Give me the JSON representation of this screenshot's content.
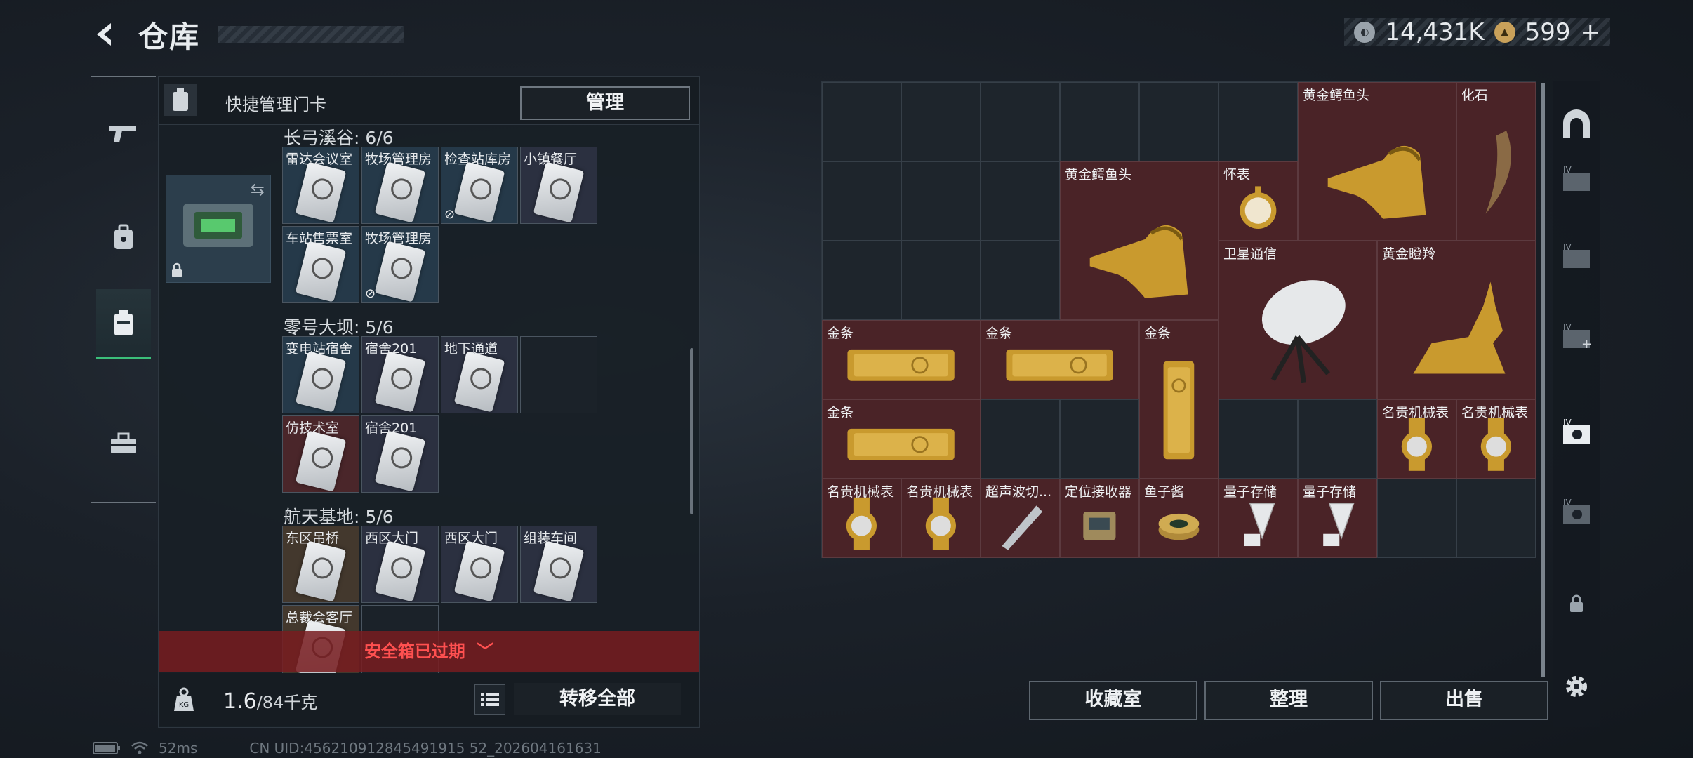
{
  "header": {
    "title": "仓库"
  },
  "currency": {
    "coin1": "14,431K",
    "coin2": "599",
    "coin2_plus": "+"
  },
  "quick_manage": {
    "label": "快捷管理门卡",
    "manage_button": "管理"
  },
  "sections": [
    {
      "title": "长弓溪谷: 6/6",
      "cards": [
        {
          "label": "雷达会议室",
          "bg": "bg-blue"
        },
        {
          "label": "牧场管理房",
          "bg": "bg-blue"
        },
        {
          "label": "检查站库房",
          "bg": "bg-blue",
          "nouse": true
        },
        {
          "label": "小镇餐厅",
          "bg": "bg-purple"
        },
        {
          "label": "车站售票室",
          "bg": "bg-blue"
        },
        {
          "label": "牧场管理房",
          "bg": "bg-blue",
          "nouse": true
        }
      ]
    },
    {
      "title": "零号大坝: 5/6",
      "cards": [
        {
          "label": "变电站宿舍",
          "bg": "bg-blue"
        },
        {
          "label": "宿舍201",
          "bg": "bg-purple"
        },
        {
          "label": "地下通道",
          "bg": "bg-purple"
        },
        {
          "label": "",
          "bg": "bg-empty",
          "empty": true
        },
        {
          "label": "仿技术室",
          "bg": "bg-red"
        },
        {
          "label": "宿舍201",
          "bg": "bg-purple"
        }
      ]
    },
    {
      "title": "航天基地: 5/6",
      "cards": [
        {
          "label": "东区吊桥",
          "bg": "bg-brown"
        },
        {
          "label": "西区大门",
          "bg": "bg-purple"
        },
        {
          "label": "西区大门",
          "bg": "bg-purple"
        },
        {
          "label": "组装车间",
          "bg": "bg-purple"
        },
        {
          "label": "总裁会客厅",
          "bg": "bg-brown"
        },
        {
          "label": "",
          "bg": "bg-empty",
          "empty": true
        }
      ]
    }
  ],
  "safe_box_status": "安全箱已过期",
  "capacity": {
    "current": "1.6",
    "max": "/84千克",
    "transfer_button": "转移全部"
  },
  "status_bar": {
    "ping": "52ms",
    "uid": "CN UID:456210912845491915 52_202604161631"
  },
  "stash_items": [
    {
      "name": "黄金鳄鱼头",
      "icon": "gold-croc",
      "col": 6,
      "row": 0,
      "w": 2,
      "h": 2
    },
    {
      "name": "化石",
      "icon": "fossil",
      "col": 8,
      "row": 0,
      "w": 1,
      "h": 2
    },
    {
      "name": "黄金鳄鱼头",
      "icon": "gold-croc",
      "col": 3,
      "row": 1,
      "w": 2,
      "h": 2
    },
    {
      "name": "怀表",
      "icon": "pocket-watch",
      "col": 5,
      "row": 1,
      "w": 1,
      "h": 1
    },
    {
      "name": "卫星通信",
      "icon": "sat-dish",
      "col": 5,
      "row": 2,
      "w": 2,
      "h": 2
    },
    {
      "name": "黄金瞪羚",
      "icon": "gold-gazelle",
      "col": 7,
      "row": 2,
      "w": 2,
      "h": 2
    },
    {
      "name": "金条",
      "icon": "gold-bar",
      "col": 0,
      "row": 3,
      "w": 2,
      "h": 1
    },
    {
      "name": "金条",
      "icon": "gold-bar",
      "col": 2,
      "row": 3,
      "w": 2,
      "h": 1
    },
    {
      "name": "金条",
      "icon": "gold-bar-v",
      "col": 4,
      "row": 3,
      "w": 1,
      "h": 2
    },
    {
      "name": "金条",
      "icon": "gold-bar",
      "col": 0,
      "row": 4,
      "w": 2,
      "h": 1
    },
    {
      "name": "名贵机械表",
      "icon": "watch",
      "col": 7,
      "row": 4,
      "w": 1,
      "h": 1
    },
    {
      "name": "名贵机械表",
      "icon": "watch",
      "col": 8,
      "row": 4,
      "w": 1,
      "h": 1
    },
    {
      "name": "名贵机械表",
      "icon": "watch",
      "col": 0,
      "row": 5,
      "w": 1,
      "h": 1
    },
    {
      "name": "名贵机械表",
      "icon": "watch",
      "col": 1,
      "row": 5,
      "w": 1,
      "h": 1
    },
    {
      "name": "超声波切...",
      "icon": "cutter",
      "col": 2,
      "row": 5,
      "w": 1,
      "h": 1
    },
    {
      "name": "定位接收器",
      "icon": "receiver",
      "col": 3,
      "row": 5,
      "w": 1,
      "h": 1
    },
    {
      "name": "鱼子酱",
      "icon": "caviar",
      "col": 4,
      "row": 5,
      "w": 1,
      "h": 1
    },
    {
      "name": "量子存储",
      "icon": "usb",
      "col": 5,
      "row": 5,
      "w": 1,
      "h": 1
    },
    {
      "name": "量子存储",
      "icon": "usb",
      "col": 6,
      "row": 5,
      "w": 1,
      "h": 1
    }
  ],
  "bottom_buttons": {
    "collection": "收藏室",
    "sort": "整理",
    "sell": "出售"
  },
  "colors": {
    "accent_green": "#3bbf7a",
    "item_bg": "#4a2327",
    "expired_red": "#ff5050"
  }
}
